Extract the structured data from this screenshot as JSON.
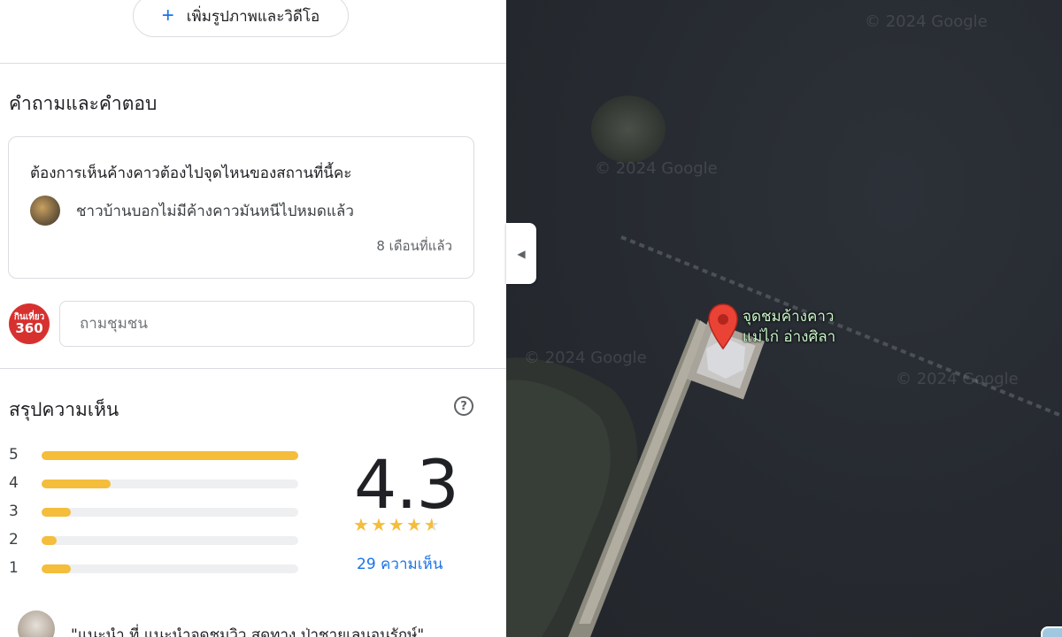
{
  "add_media": {
    "icon": "plus-icon",
    "label": "เพิ่มรูปภาพและวิดีโอ"
  },
  "qa": {
    "title": "คำถามและคำตอบ",
    "question": "ต้องการเห็นค้างคาวต้องไปจุดไหนของสถานที่นี้คะ",
    "answer": "ชาวบ้านบอกไม่มีค้างคาวมันหนีไปหมดแล้ว",
    "time": "8 เดือนที่แล้ว",
    "ask_placeholder": "ถามชุมชน",
    "profile_badge_line1": "กินเที่ยว",
    "profile_badge_line2": "360"
  },
  "summary": {
    "title": "สรุปความเห็น",
    "help_icon": "help-circle-icon",
    "help_glyph": "?",
    "distribution": [
      {
        "stars": "5",
        "fraction": 1.0
      },
      {
        "stars": "4",
        "fraction": 0.27
      },
      {
        "stars": "3",
        "fraction": 0.115
      },
      {
        "stars": "2",
        "fraction": 0.06
      },
      {
        "stars": "1",
        "fraction": 0.115
      }
    ],
    "score": "4.3",
    "star_rating": 4.5,
    "review_count": "29 ความเห็น",
    "bar_color": "#f4bd3b"
  },
  "review": {
    "snippet": "\"แนะนำ ที่ แนะนำจุดชมวิว สุดทาง ป่าชายเลนอนุรักษ์\""
  },
  "map": {
    "place_label_line1": "จุดชมค้างคาว",
    "place_label_line2": "แม่ไก่ อ่างศิลา",
    "watermark": "© 2024 Google",
    "pin_color": "#ea4335",
    "collapse_icon": "caret-left-icon",
    "collapse_glyph": "◀"
  }
}
